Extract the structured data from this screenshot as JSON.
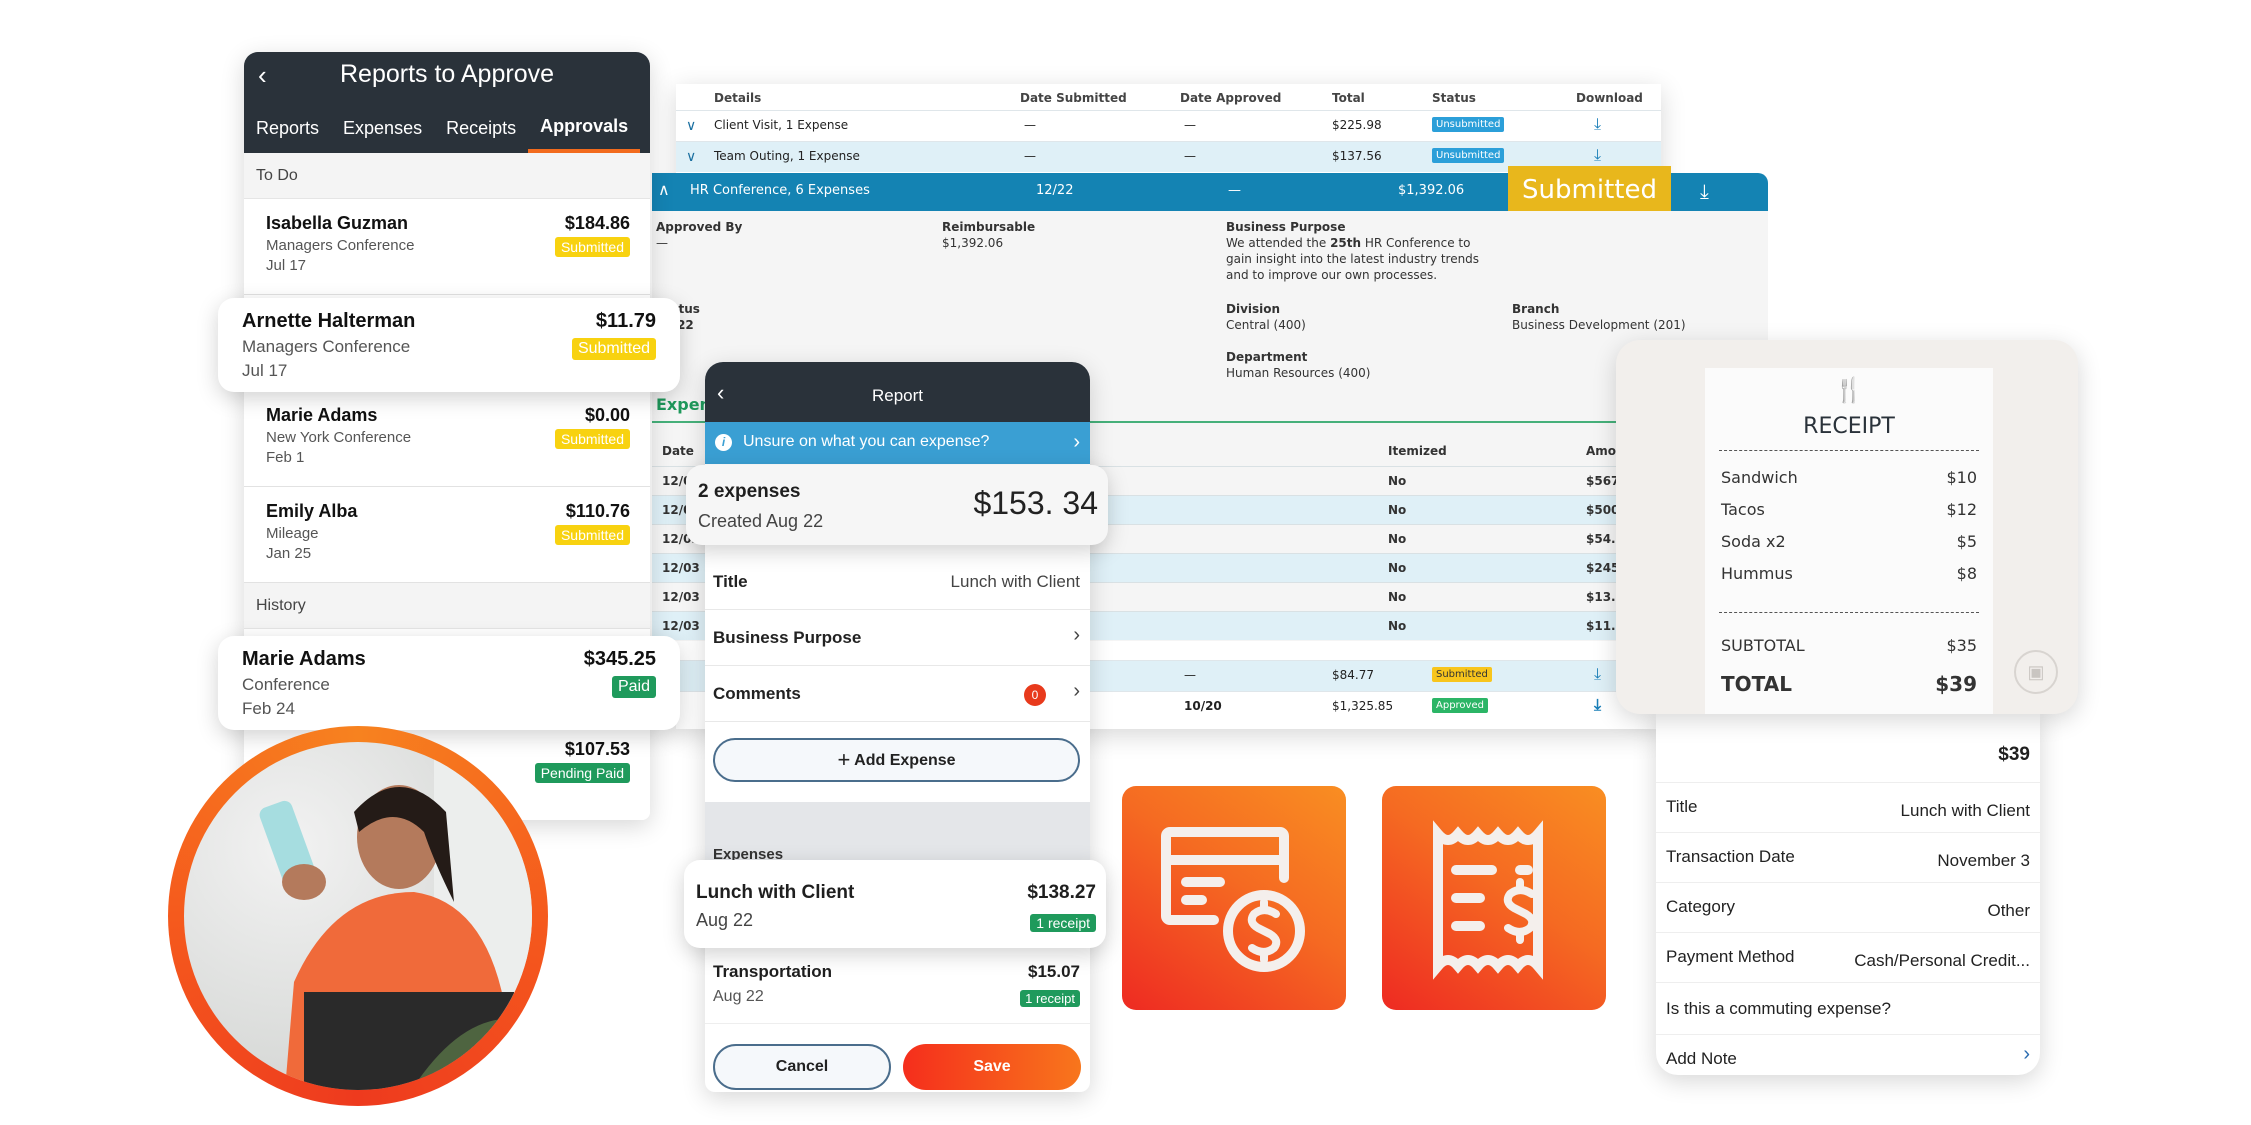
{
  "approvals": {
    "title": "Reports to Approve",
    "tabs": [
      "Reports",
      "Expenses",
      "Receipts",
      "Approvals"
    ],
    "active_tab": "Approvals",
    "todo_label": "To Do",
    "history_label": "History",
    "todo": [
      {
        "name": "Isabella Guzman",
        "sub": "Managers Conference",
        "date": "Jul 17",
        "amount": "$184.86",
        "status": "Submitted"
      },
      {
        "name": "Arnette Halterman",
        "sub": "Managers Conference",
        "date": "Jul 17",
        "amount": "$11.79",
        "status": "Submitted"
      },
      {
        "name": "Marie Adams",
        "sub": "New York Conference",
        "date": "Feb 1",
        "amount": "$0.00",
        "status": "Submitted"
      },
      {
        "name": "Emily Alba",
        "sub": "Mileage",
        "date": "Jan 25",
        "amount": "$110.76",
        "status": "Submitted"
      }
    ],
    "history": [
      {
        "name": "Marie Adams",
        "sub": "Conference",
        "date": "Feb 24",
        "amount": "$345.25",
        "status": "Paid"
      },
      {
        "name": "",
        "sub": "",
        "date": "",
        "amount": "$107.53",
        "status": "Pending Paid"
      }
    ]
  },
  "reports_table": {
    "headers": [
      "Details",
      "Date Submitted",
      "Date Approved",
      "Total",
      "Status",
      "Download"
    ],
    "rows": [
      {
        "details": "Client Visit, 1 Expense",
        "submitted": "—",
        "approved": "—",
        "total": "$225.98",
        "status": "Unsubmitted"
      },
      {
        "details": "Team Outing, 1 Expense",
        "submitted": "—",
        "approved": "—",
        "total": "$137.56",
        "status": "Unsubmitted"
      }
    ],
    "expanded": {
      "details": "HR Conference, 6 Expenses",
      "submitted": "12/22",
      "approved": "—",
      "total": "$1,392.06",
      "status": "Submitted"
    },
    "detail": {
      "approved_by_label": "Approved By",
      "approved_by": "—",
      "reimbursable_label": "Reimbursable",
      "reimbursable": "$1,392.06",
      "purpose_label": "Business Purpose",
      "purpose_pre": "We attended the ",
      "purpose_bold": "25th",
      "purpose_post": " HR Conference to gain insight into the latest industry trends and to improve our own processes.",
      "status_label": "Status",
      "status_value": "12/22",
      "division_label": "Division",
      "division": "Central (400)",
      "branch_label": "Branch",
      "branch": "Business Development (201)",
      "department_label": "Department",
      "department": "Human Resources (400)",
      "expenses_label": "Expenses",
      "exp_headers": [
        "Date",
        "Itemized",
        "Amount"
      ],
      "exp_rows": [
        {
          "date": "12/03",
          "itemized": "No",
          "amount": "$567."
        },
        {
          "date": "12/03",
          "itemized": "No",
          "amount": "$500."
        },
        {
          "date": "12/03",
          "itemized": "No",
          "amount": "$54.5"
        },
        {
          "date": "12/03",
          "itemized": "No",
          "amount": "$245."
        },
        {
          "date": "12/03",
          "itemized": "No",
          "amount": "$13.7"
        },
        {
          "date": "12/03",
          "itemized": "No",
          "amount": "$11.2"
        }
      ]
    },
    "bottom_rows": [
      {
        "submitted": "—",
        "total": "$84.77",
        "status": "Submitted"
      },
      {
        "submitted": "10/20",
        "total": "$1,325.85",
        "status": "Approved"
      }
    ]
  },
  "report": {
    "title": "Report",
    "info_banner": "Unsure on what you can expense?",
    "summary_count": "2 expenses",
    "summary_created": "Created Aug 22",
    "summary_total": "$153. 34",
    "title_label": "Title",
    "title_value": "Lunch with Client",
    "purpose_label": "Business Purpose",
    "comments_label": "Comments",
    "comments_count": "0",
    "add_expense": "Add Expense",
    "expenses_label": "Expenses",
    "expenses": [
      {
        "name": "Lunch with Client",
        "date": "Aug 22",
        "amount": "$138.27",
        "receipt": "1 receipt"
      },
      {
        "name": "Transportation",
        "date": "Aug 22",
        "amount": "$15.07",
        "receipt": "1 receipt"
      }
    ],
    "cancel": "Cancel",
    "save": "Save"
  },
  "receipt": {
    "title": "RECEIPT",
    "items": [
      {
        "name": "Sandwich",
        "price": "$10"
      },
      {
        "name": "Tacos",
        "price": "$12"
      },
      {
        "name": "Soda x2",
        "price": "$5"
      },
      {
        "name": "Hummus",
        "price": "$8"
      }
    ],
    "subtotal_label": "SUBTOTAL",
    "subtotal": "$35",
    "total_label": "TOTAL",
    "total": "$39"
  },
  "expense_detail": {
    "amount": "$39",
    "fields": [
      {
        "label": "Title",
        "value": "Lunch with Client"
      },
      {
        "label": "Transaction Date",
        "value": "November 3"
      },
      {
        "label": "Category",
        "value": "Other"
      },
      {
        "label": "Payment Method",
        "value": "Cash/Personal Credit..."
      }
    ],
    "commuting": "Is this a commuting expense?",
    "add_note": "Add Note"
  },
  "icons": [
    "credit-card-dollar-icon",
    "receipt-dollar-icon"
  ],
  "colors": {
    "accent_orange": "#f26b1d",
    "dark_header": "#2a323a",
    "blue_bar": "#1483b3",
    "submitted_yellow": "#f8d210",
    "paid_green": "#1f9a5c"
  }
}
